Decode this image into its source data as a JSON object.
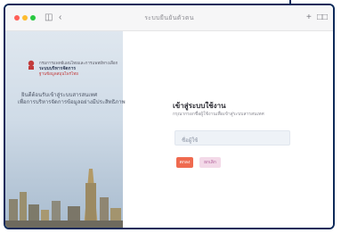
{
  "window": {
    "url": "ระบบยืนยันตัวตน"
  },
  "brand": {
    "org_line1": "กรมการแพทย์แผนไทยและการแพทย์ทางเลือก",
    "org_line2": "ระบบบริหารจัดการ",
    "org_line3": "ฐานข้อมูลสมุนไพรไทย",
    "tagline_line1": "ยินดีต้อนรับเข้าสู่ระบบสารสนเทศ",
    "tagline_line2": "เพื่อการบริหารจัดการข้อมูลอย่างมีประสิทธิภาพ",
    "accent_color": "#c23b3b"
  },
  "login": {
    "title": "เข้าสู่ระบบใช้งาน",
    "subtitle": "กรุณากรอกชื่อผู้ใช้งานเพื่อเข้าสู่ระบบสารสนเทศ",
    "username_placeholder": "ชื่อผู้ใช้",
    "submit_label": "ตกลง",
    "cancel_label": "ยกเลิก",
    "primary_color": "#ef6a4f",
    "secondary_color": "#f3d9e8"
  }
}
